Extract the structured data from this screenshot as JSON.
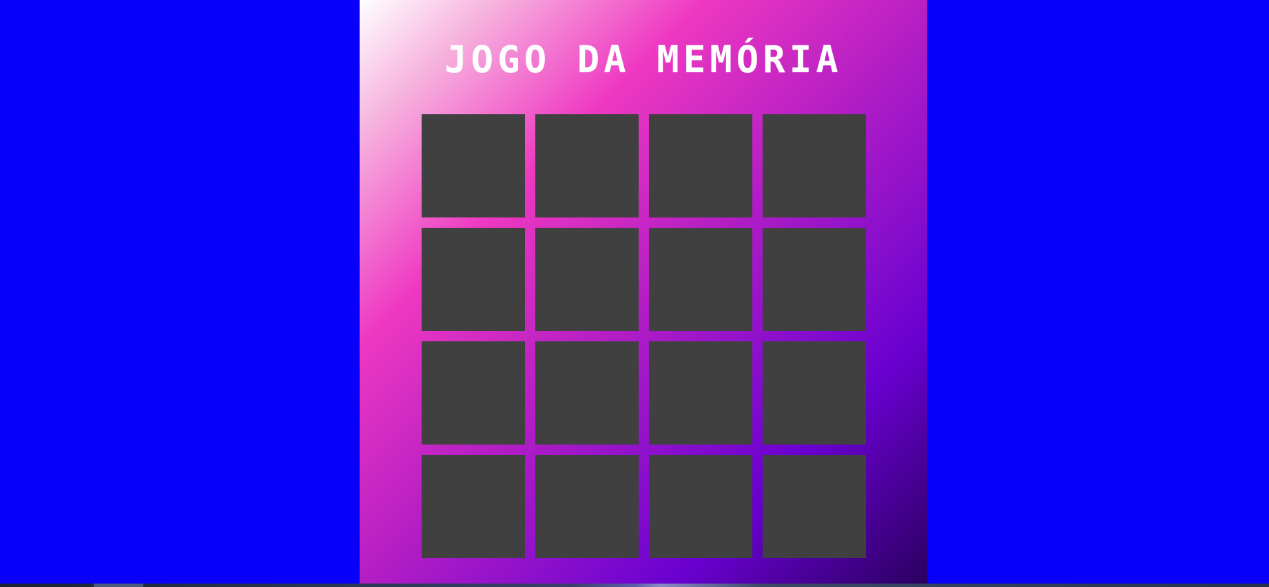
{
  "page": {
    "title": "JOGO DA MEMÓRIA",
    "background_color": "#0800f8",
    "card_back_color": "#404040"
  },
  "board": {
    "rows": 4,
    "columns": 4,
    "cards": [
      {
        "state": "face-down"
      },
      {
        "state": "face-down"
      },
      {
        "state": "face-down"
      },
      {
        "state": "face-down"
      },
      {
        "state": "face-down"
      },
      {
        "state": "face-down"
      },
      {
        "state": "face-down"
      },
      {
        "state": "face-down"
      },
      {
        "state": "face-down"
      },
      {
        "state": "face-down"
      },
      {
        "state": "face-down"
      },
      {
        "state": "face-down"
      },
      {
        "state": "face-down"
      },
      {
        "state": "face-down"
      },
      {
        "state": "face-down"
      },
      {
        "state": "face-down"
      }
    ]
  }
}
